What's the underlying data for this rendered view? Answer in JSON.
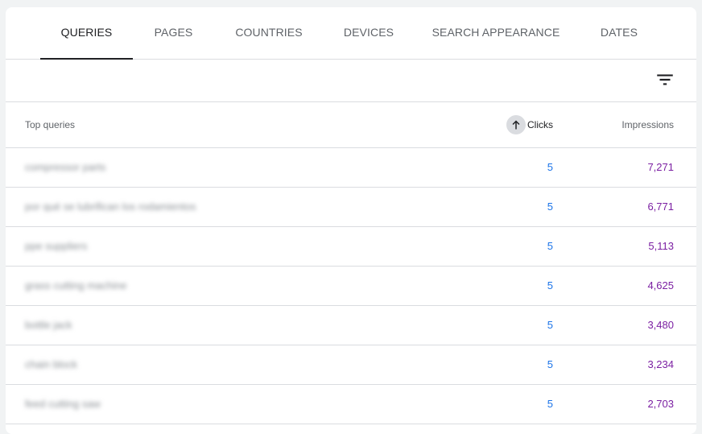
{
  "tabs": [
    {
      "label": "QUERIES",
      "active": true
    },
    {
      "label": "PAGES",
      "active": false
    },
    {
      "label": "COUNTRIES",
      "active": false
    },
    {
      "label": "DEVICES",
      "active": false
    },
    {
      "label": "SEARCH APPEARANCE",
      "active": false
    },
    {
      "label": "DATES",
      "active": false
    }
  ],
  "toolbar": {
    "filter_icon": "filter-icon"
  },
  "table": {
    "headers": {
      "query": "Top queries",
      "clicks": "Clicks",
      "impressions": "Impressions",
      "sort_icon": "arrow-up-icon"
    },
    "rows": [
      {
        "query": "compressor parts",
        "clicks": "5",
        "impressions": "7,271"
      },
      {
        "query": "por qué se lubrifican los rodamientos",
        "clicks": "5",
        "impressions": "6,771"
      },
      {
        "query": "ppe suppliers",
        "clicks": "5",
        "impressions": "5,113"
      },
      {
        "query": "grass cutting machine",
        "clicks": "5",
        "impressions": "4,625"
      },
      {
        "query": "bottle jack",
        "clicks": "5",
        "impressions": "3,480"
      },
      {
        "query": "chain block",
        "clicks": "5",
        "impressions": "3,234"
      },
      {
        "query": "feed cutting saw",
        "clicks": "5",
        "impressions": "2,703"
      }
    ]
  },
  "colors": {
    "clicks": "#1a73e8",
    "impressions": "#7b1fa2",
    "active_tab": "#202124"
  }
}
